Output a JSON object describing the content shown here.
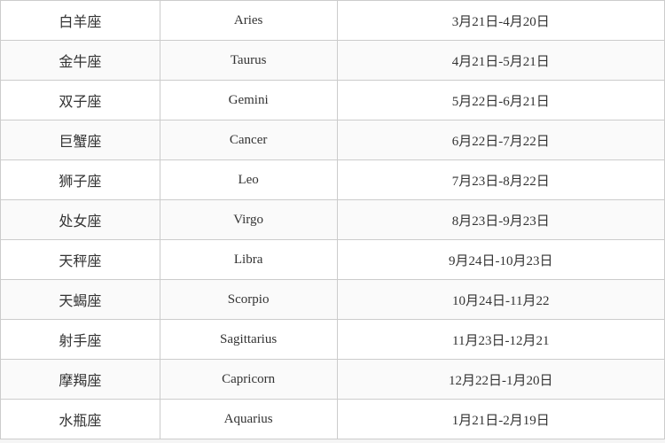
{
  "table": {
    "rows": [
      {
        "chinese": "白羊座",
        "english": "Aries",
        "dates": "3月21日-4月20日"
      },
      {
        "chinese": "金牛座",
        "english": "Taurus",
        "dates": "4月21日-5月21日"
      },
      {
        "chinese": "双子座",
        "english": "Gemini",
        "dates": "5月22日-6月21日"
      },
      {
        "chinese": "巨蟹座",
        "english": "Cancer",
        "dates": "6月22日-7月22日"
      },
      {
        "chinese": "狮子座",
        "english": "Leo",
        "dates": "7月23日-8月22日"
      },
      {
        "chinese": "处女座",
        "english": "Virgo",
        "dates": "8月23日-9月23日"
      },
      {
        "chinese": "天秤座",
        "english": "Libra",
        "dates": "9月24日-10月23日"
      },
      {
        "chinese": "天蝎座",
        "english": "Scorpio",
        "dates": "10月24日-11月22"
      },
      {
        "chinese": "射手座",
        "english": "Sagittarius",
        "dates": "11月23日-12月21"
      },
      {
        "chinese": "摩羯座",
        "english": "Capricorn",
        "dates": "12月22日-1月20日"
      },
      {
        "chinese": "水瓶座",
        "english": "Aquarius",
        "dates": "1月21日-2月19日"
      }
    ]
  }
}
